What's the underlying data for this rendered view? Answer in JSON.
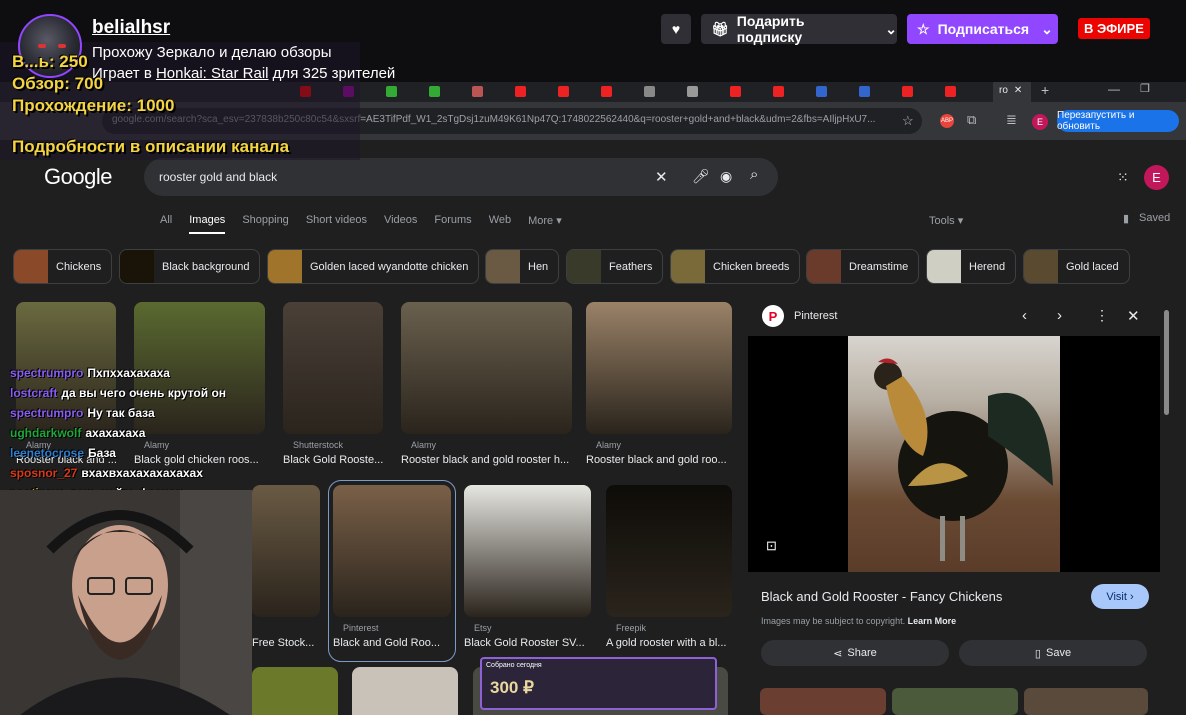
{
  "stream": {
    "streamer": "belialhsr",
    "title": "Прохожу Зеркало и делаю обзоры",
    "game_prefix": "Играет в ",
    "game": "Honkai: Star Rail",
    "viewers_suffix": " для 325 зрителей",
    "gift_label": "Подарить подписку",
    "subscribe_label": "Подписаться",
    "live_label": "В ЭФИРЕ"
  },
  "overlay": {
    "achievements": [
      "В...ь: 250",
      "Обзор: 700",
      "Прохождение: 1000"
    ],
    "details": "Подробности в описании канала",
    "donation_label": "Собрано сегодня",
    "donation_amount": "300 ₽"
  },
  "chat": [
    {
      "nick": "spectrumpro",
      "color": "#8a5cf6",
      "msg": "Пхпххахахаха"
    },
    {
      "nick": "lostcraft",
      "color": "#8a5cf6",
      "msg": "да вы чего очень крутой он"
    },
    {
      "nick": "spectrumpro",
      "color": "#8a5cf6",
      "msg": "Ну так база"
    },
    {
      "nick": "ughdarkwolf",
      "color": "#1fa83a",
      "msg": "ахахахаха"
    },
    {
      "nick": "leenetocrose",
      "color": "#2d7fd1",
      "msg": "База"
    },
    {
      "nick": "sposnor_27",
      "color": "#d93a1a",
      "msg": "вхахвхахахахахахах"
    },
    {
      "nick": "postigaya",
      "color": "#d0a020",
      "msg": "день хейта фаенон"
    }
  ],
  "browser": {
    "url": "google.com/search?sca_esv=237838b250c80c54&sxsrf=AE3TifPdf_W1_2sTgDsj1zuM49K61Np47Q:1748022562440&q=rooster+gold+and+black&udm=2&fbs=AIljpHxU7...",
    "active_tab": "ro",
    "relaunch_label": "Перезапустить и обновить",
    "tab_icons": [
      "red",
      "#a0a",
      "#3a3",
      "#3a3",
      "#b55",
      "#e22",
      "#e22",
      "#e22",
      "#888",
      "#999",
      "#e22",
      "#e22",
      "#36c",
      "#36c",
      "#e22",
      "#e22"
    ]
  },
  "google": {
    "logo": "Google",
    "query": "rooster gold and black",
    "filters": [
      "All",
      "Images",
      "Shopping",
      "Short videos",
      "Videos",
      "Forums",
      "Web",
      "More ▾"
    ],
    "selected_filter": "Images",
    "tools": "Tools ▾",
    "saved": "Saved",
    "account_initial": "E",
    "chips": [
      {
        "label": "Chickens",
        "color": "#8a4a2a"
      },
      {
        "label": "Black background",
        "color": "#1a1408"
      },
      {
        "label": "Golden laced wyandotte chicken",
        "color": "#a0742a"
      },
      {
        "label": "Hen",
        "color": "#6a5a44"
      },
      {
        "label": "Feathers",
        "color": "#3a3a2a"
      },
      {
        "label": "Chicken breeds",
        "color": "#7a6a3a"
      },
      {
        "label": "Dreamstime",
        "color": "#6a3a2a"
      },
      {
        "label": "Herend",
        "color": "#cfcfc4"
      },
      {
        "label": "Gold laced",
        "color": "#5a4a30"
      }
    ],
    "results": [
      {
        "source": "Alamy",
        "caption": "Rooster black and ...",
        "color": "#6a6a40"
      },
      {
        "source": "Alamy",
        "caption": "Black gold chicken roos...",
        "color": "#5a6a30"
      },
      {
        "source": "Shutterstock",
        "caption": "Black Gold Rooste...",
        "color": "#4a4038"
      },
      {
        "source": "Alamy",
        "caption": "Rooster black and gold rooster h...",
        "color": "#6a604e"
      },
      {
        "source": "Alamy",
        "caption": "Rooster black and gold roo...",
        "color": "#9a8268"
      },
      {
        "source": "",
        "caption": "Free Stock...",
        "color": "#6a5a44"
      },
      {
        "source": "Pinterest",
        "caption": "Black and Gold Roo...",
        "color": "#7a6048"
      },
      {
        "source": "Etsy",
        "caption": "Black Gold Rooster SV...",
        "color": "#e6e6e0"
      },
      {
        "source": "Freepik",
        "caption": "A gold rooster with a bl...",
        "color": "#0e0c08"
      }
    ]
  },
  "panel": {
    "source": "Pinterest",
    "title": "Black and Gold Rooster - Fancy Chickens",
    "visit_label": "Visit ›",
    "copyright": "Images may be subject to copyright.",
    "learn_more": "Learn More",
    "share_label": "Share",
    "save_label": "Save"
  }
}
